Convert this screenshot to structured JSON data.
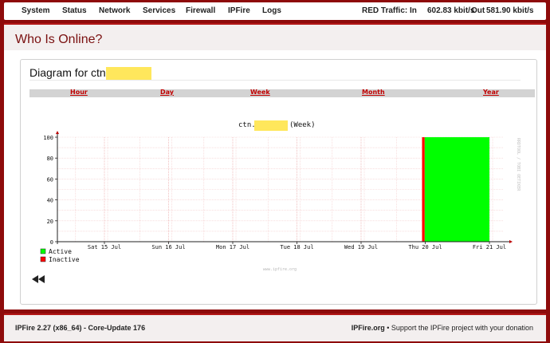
{
  "nav": [
    "System",
    "Status",
    "Network",
    "Services",
    "Firewall",
    "IPFire",
    "Logs"
  ],
  "traffic": {
    "in_label": "RED Traffic: In",
    "in_value": "602.83 kbit/s",
    "out_label": "Out",
    "out_value": "581.90 kbit/s"
  },
  "page": {
    "title": "Who Is Online?"
  },
  "diagram": {
    "title_prefix": "Diagram for ctn",
    "tabs": [
      "Hour",
      "Day",
      "Week",
      "Month",
      "Year"
    ],
    "back_icon": "double-left-arrow-icon"
  },
  "chart_data": {
    "type": "area",
    "title_prefix": "ctn.",
    "title_suffix": "(Week)",
    "x": [
      "Sat 15 Jul",
      "Sun 16 Jul",
      "Mon 17 Jul",
      "Tue 18 Jul",
      "Wed 19 Jul",
      "Thu 20 Jul",
      "Fri 21 Jul"
    ],
    "ylim": [
      0,
      100
    ],
    "yticks": [
      0,
      20,
      40,
      60,
      80,
      100
    ],
    "series": [
      {
        "name": "Active",
        "color": "#00ff00",
        "segments": [
          [
            19.99,
            21.0
          ]
        ],
        "value": 100
      },
      {
        "name": "Inactive",
        "color": "#ff0000",
        "segments": [
          [
            19.95,
            19.99
          ]
        ],
        "value": 100
      }
    ],
    "watermark": "www.ipfire.org",
    "side_text": "RRDTOOL / TOBI OETIKER",
    "grid": true,
    "legend": "bottom-left"
  },
  "footer": {
    "version": "IPFire 2.27 (x86_64) - Core-Update 176",
    "site": "IPFire.org",
    "support": "• Support the IPFire project with your donation"
  },
  "colors": {
    "brand": "#8e0b0b",
    "link": "#c00000",
    "redact": "#ffe75c"
  }
}
